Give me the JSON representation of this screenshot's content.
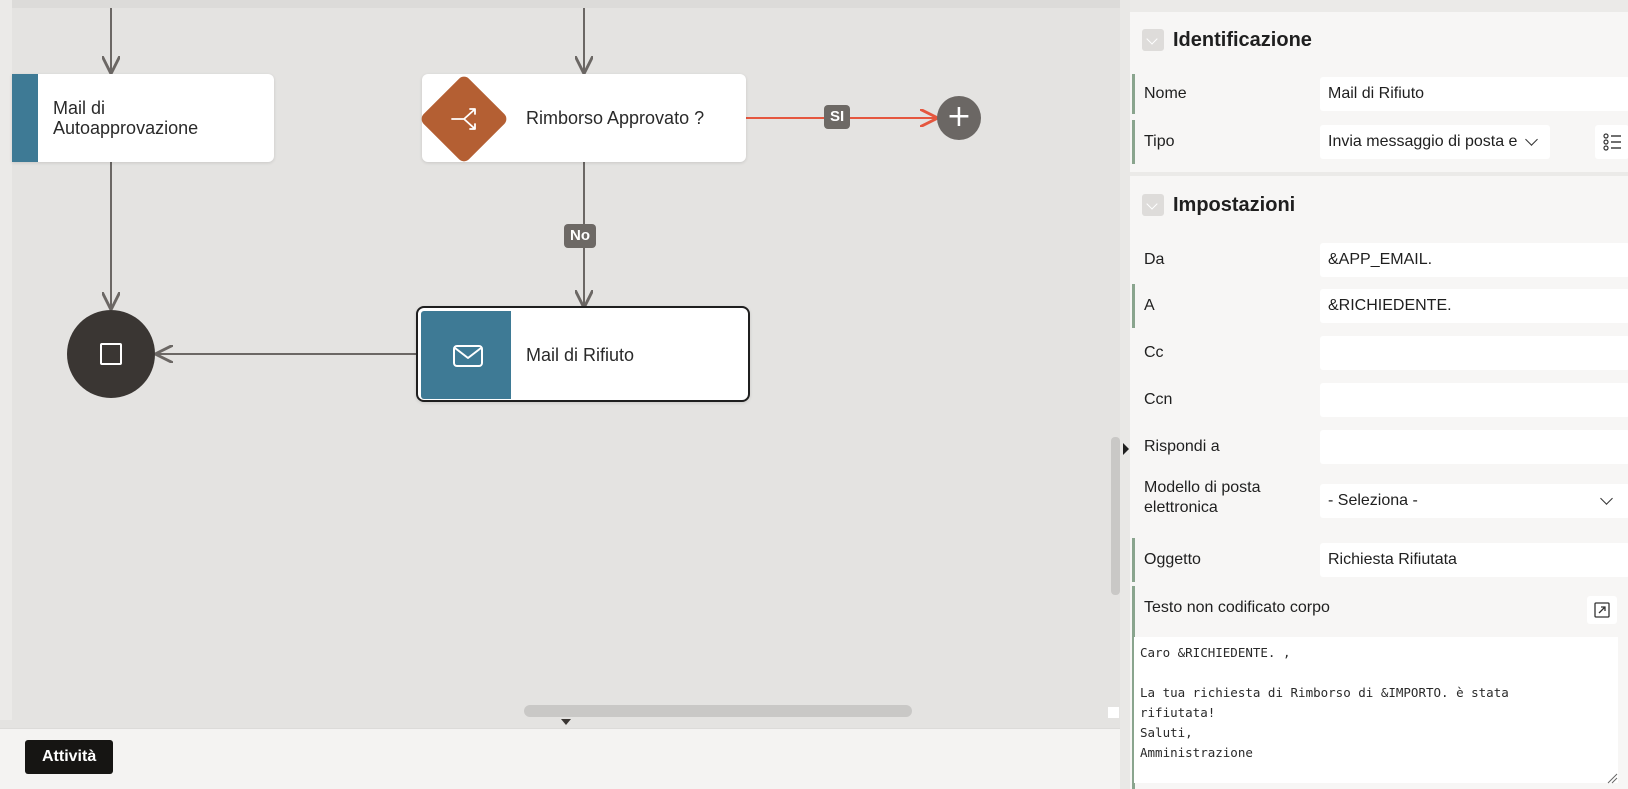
{
  "diagram": {
    "node_autoapprove": "Mail di\nAutoapprovazione",
    "node_decision": "Rimborso Approvato ?",
    "node_reject": "Mail di Rifiuto",
    "label_si": "SI",
    "label_no": "No",
    "add_symbol": "+"
  },
  "bottom": {
    "tab_activities": "Attività"
  },
  "colors": {
    "accent_blue": "#3e7a95",
    "decision_orange": "#b45f33",
    "selected_edge": "#e5573f",
    "end_node": "#3a3633"
  },
  "panel": {
    "identification": {
      "title": "Identificazione",
      "name_label": "Nome",
      "name_value": "Mail di Rifiuto",
      "type_label": "Tipo",
      "type_value": "Invia messaggio di posta e"
    },
    "settings": {
      "title": "Impostazioni",
      "from_label": "Da",
      "from_value": "&APP_EMAIL.",
      "to_label": "A",
      "to_value": "&RICHIEDENTE.",
      "cc_label": "Cc",
      "cc_value": "",
      "bcc_label": "Ccn",
      "bcc_value": "",
      "reply_label": "Rispondi a",
      "reply_value": "",
      "template_label": "Modello di posta elettronica",
      "template_value": "- Seleziona -",
      "subject_label": "Oggetto",
      "subject_value": "Richiesta Rifiutata",
      "body_label": "Testo non codificato corpo",
      "body_value": "Caro &RICHIEDENTE. ,\n\nLa tua richiesta di Rimborso di &IMPORTO. è stata\nrifiutata!\nSaluti,\nAmministrazione"
    }
  }
}
